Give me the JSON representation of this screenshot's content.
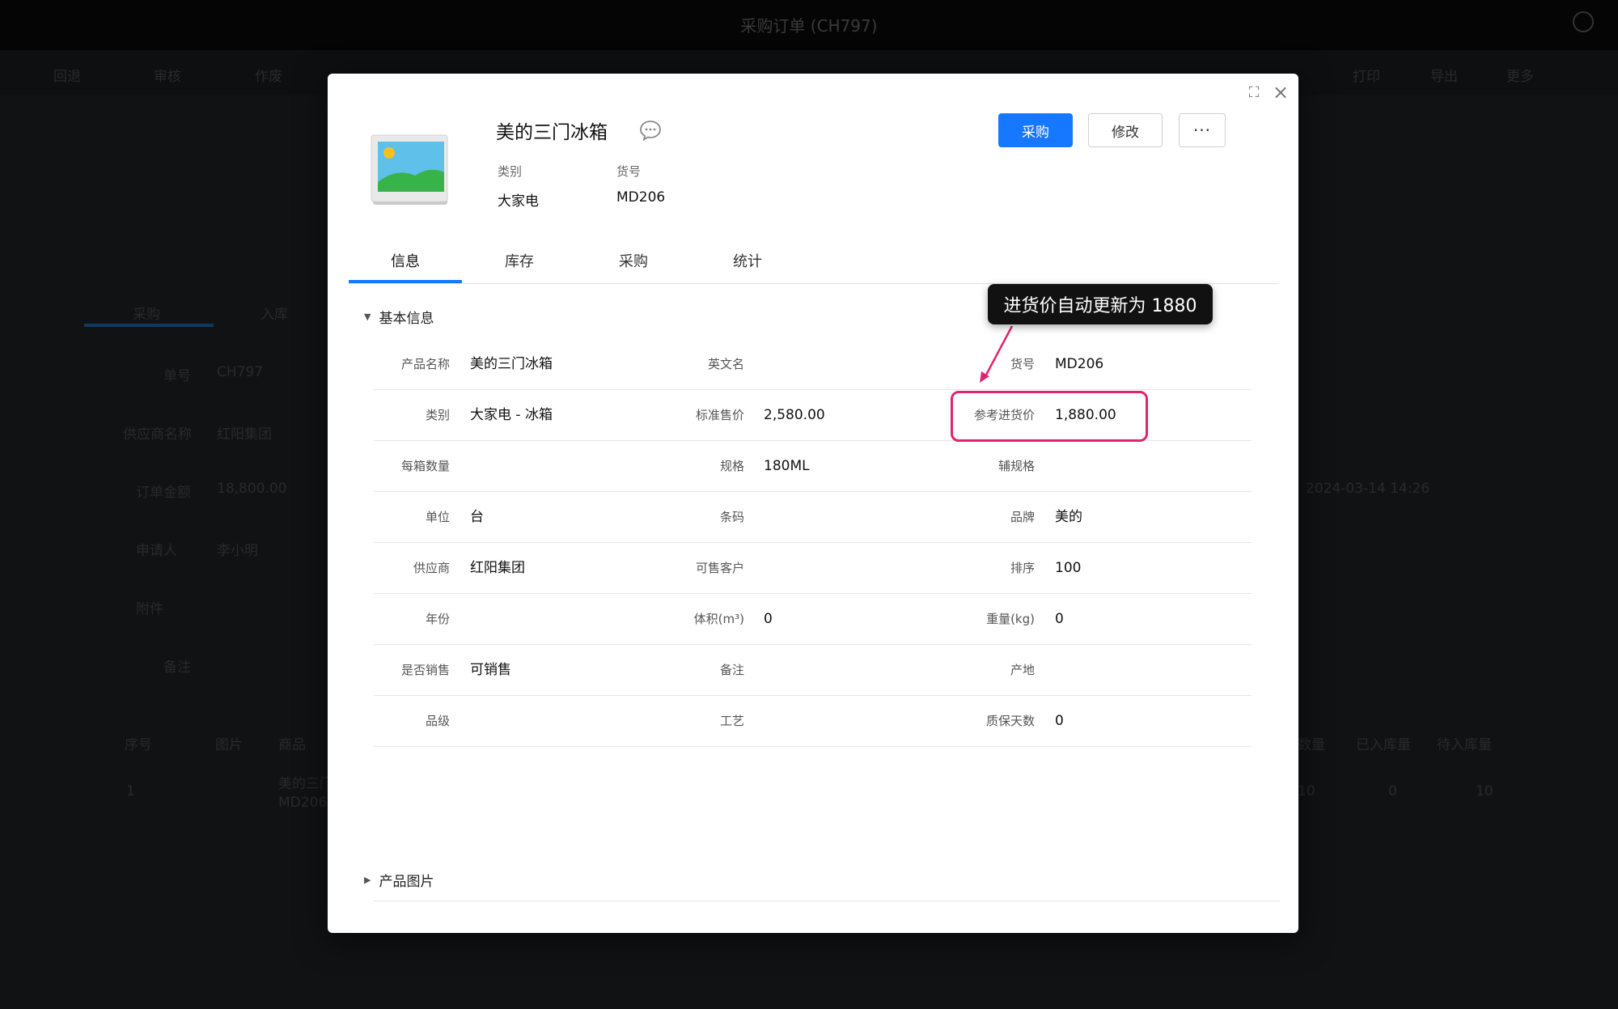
{
  "background": {
    "title": "采购订单 (CH797)",
    "toolbar": [
      "回退",
      "审核",
      "作废",
      "打印",
      "导出",
      "更多"
    ],
    "tabs": [
      "采购",
      "入库"
    ],
    "field_labels": [
      "单号",
      "供应商名称",
      "订单金额",
      "申请人",
      "备注",
      "附件"
    ],
    "field_values": [
      "CH797",
      "红阳集团",
      "18,800.00",
      "李小明"
    ],
    "table_headers": [
      "序号",
      "图片",
      "商品",
      "数量",
      "已入库量",
      "待入库量"
    ],
    "row": {
      "no": "1",
      "name": "美的三门冰箱",
      "sku": "MD206",
      "qty": "10",
      "in": "0",
      "pending": "10"
    },
    "right_date": "2024-03-14 14:26"
  },
  "product": {
    "name": "美的三门冰箱",
    "category_label": "类别",
    "category_value": "大家电",
    "sku_label": "货号",
    "sku_value": "MD206"
  },
  "actions": {
    "purchase": "采购",
    "edit": "修改",
    "more": "···"
  },
  "tabs": [
    "信息",
    "库存",
    "采购",
    "统计"
  ],
  "sections": {
    "basic": "基本信息",
    "images": "产品图片"
  },
  "rows": [
    [
      {
        "label": "产品名称",
        "value": "美的三门冰箱"
      },
      {
        "label": "英文名",
        "value": ""
      },
      {
        "label": "货号",
        "value": "MD206"
      }
    ],
    [
      {
        "label": "类别",
        "value": "大家电 - 冰箱"
      },
      {
        "label": "标准售价",
        "value": "2,580.00"
      },
      {
        "label": "参考进货价",
        "value": "1,880.00"
      }
    ],
    [
      {
        "label": "每箱数量",
        "value": ""
      },
      {
        "label": "规格",
        "value": "180ML"
      },
      {
        "label": "辅规格",
        "value": ""
      }
    ],
    [
      {
        "label": "单位",
        "value": "台"
      },
      {
        "label": "条码",
        "value": ""
      },
      {
        "label": "品牌",
        "value": "美的"
      }
    ],
    [
      {
        "label": "供应商",
        "value": "红阳集团"
      },
      {
        "label": "可售客户",
        "value": ""
      },
      {
        "label": "排序",
        "value": "100"
      }
    ],
    [
      {
        "label": "年份",
        "value": ""
      },
      {
        "label": "体积(m³)",
        "value": "0"
      },
      {
        "label": "重量(kg)",
        "value": "0"
      }
    ],
    [
      {
        "label": "是否销售",
        "value": "可销售"
      },
      {
        "label": "备注",
        "value": ""
      },
      {
        "label": "产地",
        "value": ""
      }
    ],
    [
      {
        "label": "品级",
        "value": ""
      },
      {
        "label": "工艺",
        "value": ""
      },
      {
        "label": "质保天数",
        "value": "0"
      }
    ]
  ],
  "annotation": {
    "text": "进货价自动更新为 1880",
    "color": "#e0246e"
  },
  "colors": {
    "primary": "#1677ff",
    "highlight": "#e0246e"
  }
}
